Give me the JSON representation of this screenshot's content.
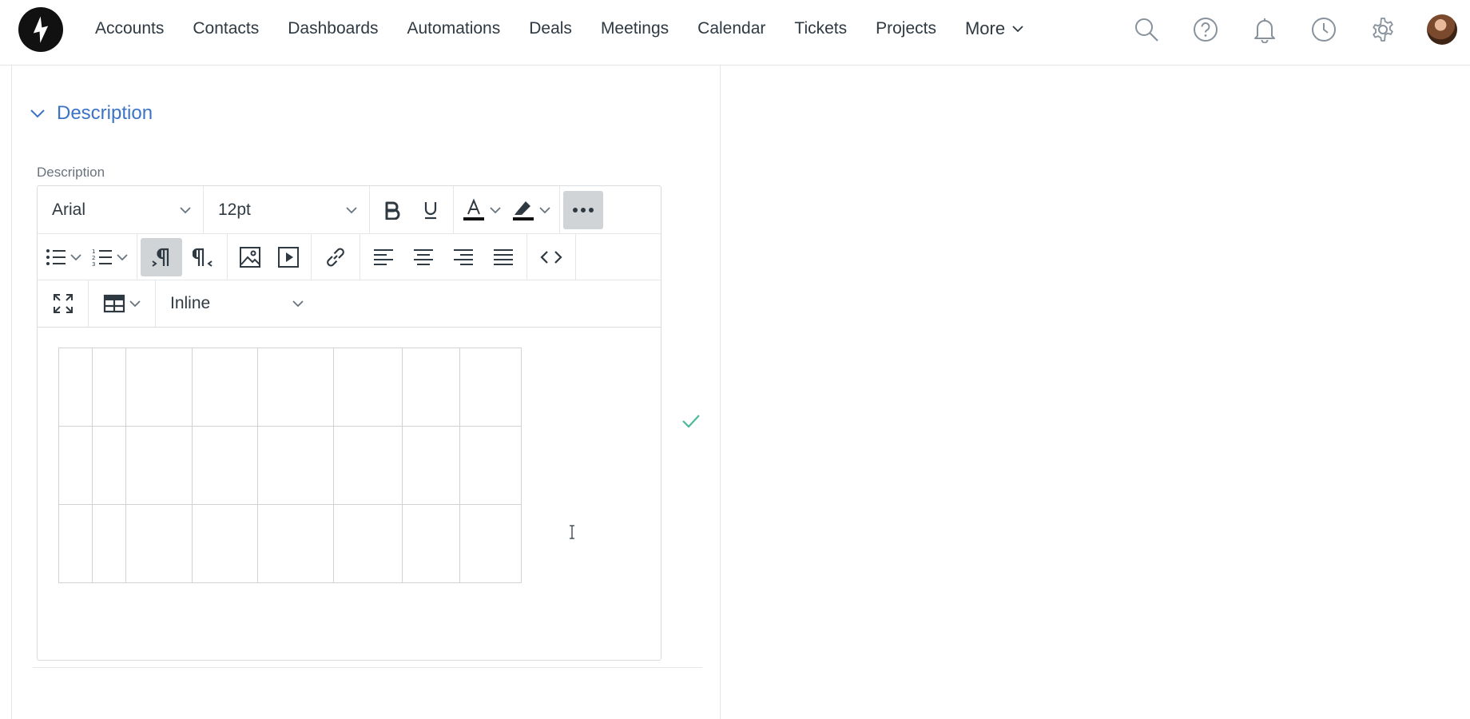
{
  "nav": {
    "items": [
      "Accounts",
      "Contacts",
      "Dashboards",
      "Automations",
      "Deals",
      "Meetings",
      "Calendar",
      "Tickets",
      "Projects"
    ],
    "more_label": "More",
    "icons": [
      "search-icon",
      "help-icon",
      "bell-icon",
      "clock-icon",
      "gear-icon"
    ]
  },
  "section": {
    "title": "Description"
  },
  "field": {
    "label": "Description"
  },
  "editor": {
    "font_family": "Arial",
    "font_size": "12pt",
    "table_mode": "Inline",
    "table": {
      "rows": 3,
      "cols": 8
    }
  },
  "colors": {
    "accent": "#3b73c7",
    "success": "#4cb99a"
  }
}
